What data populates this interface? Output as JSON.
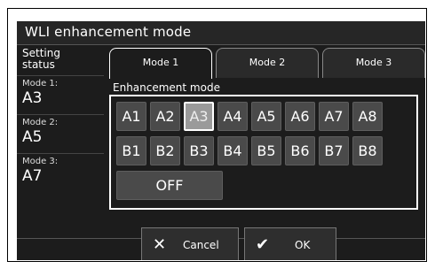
{
  "window": {
    "title": "WLI enhancement mode"
  },
  "sidebar": {
    "header": "Setting status",
    "items": [
      {
        "label": "Mode 1:",
        "value": "A3"
      },
      {
        "label": "Mode 2:",
        "value": "A5"
      },
      {
        "label": "Mode 3:",
        "value": "A7"
      }
    ]
  },
  "tabs": [
    {
      "label": "Mode 1",
      "active": true
    },
    {
      "label": "Mode 2",
      "active": false
    },
    {
      "label": "Mode 3",
      "active": false
    }
  ],
  "enhancement": {
    "section_label": "Enhancement mode",
    "row_a": [
      "A1",
      "A2",
      "A3",
      "A4",
      "A5",
      "A6",
      "A7",
      "A8"
    ],
    "row_b": [
      "B1",
      "B2",
      "B3",
      "B4",
      "B5",
      "B6",
      "B7",
      "B8"
    ],
    "selected": "A3",
    "off_label": "OFF"
  },
  "footer": {
    "cancel_label": "Cancel",
    "ok_label": "OK",
    "cancel_icon": "close-icon",
    "ok_icon": "check-icon"
  }
}
